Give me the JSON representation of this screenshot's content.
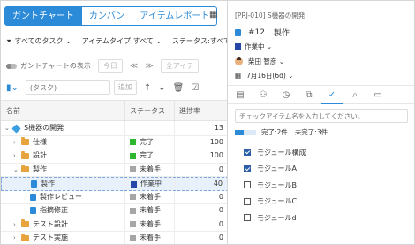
{
  "tabs": [
    {
      "label": "ガントチャート"
    },
    {
      "label": "カンバン"
    },
    {
      "label": "アイテムレポート"
    }
  ],
  "filters": [
    "すべてのタスク ⌄",
    "アイテムタイプ:すべて ⌄",
    "ステータス:すべて ⌄"
  ],
  "toolbar": {
    "gantt_toggle_label": "ガントチャートの表示",
    "today_label": "今日",
    "nav_prev": "≪",
    "nav_next": "≫",
    "all_items_label": "全アイテ"
  },
  "add_row": {
    "task_placeholder": "(タスク)",
    "add_label": "追加"
  },
  "table": {
    "columns": [
      "名前",
      "ステータス",
      "進捗率"
    ],
    "rows": [
      {
        "name": "S機器の開発",
        "status": "",
        "progress": "13"
      },
      {
        "name": "仕様",
        "status": "完了",
        "progress": "100"
      },
      {
        "name": "設計",
        "status": "完了",
        "progress": "100"
      },
      {
        "name": "製作",
        "status": "未着手",
        "progress": "0"
      },
      {
        "name": "製作",
        "status": "作業中",
        "progress": "40"
      },
      {
        "name": "製作レビュー",
        "status": "未着手",
        "progress": "0"
      },
      {
        "name": "指摘修正",
        "status": "未着手",
        "progress": "0"
      },
      {
        "name": "テスト設計",
        "status": "未着手",
        "progress": "0"
      },
      {
        "name": "テスト実施",
        "status": "未着手",
        "progress": "0"
      }
    ]
  },
  "detail": {
    "project_id": "[PRJ-010] S機器の開発",
    "item_number": "#12",
    "item_name": "製作",
    "status": "作業中 ⌄",
    "assignee": "柴田 智彦 ⌄",
    "due": "7月16日(6d) ⌄",
    "checklist_placeholder": "チェックアイテム名を入力してください。",
    "done_text": "完了:2件",
    "undone_text": "未完了:3件",
    "checklist_progress": 0.4,
    "items": [
      {
        "label": "モジュール構成",
        "checked": true
      },
      {
        "label": "モジュールA",
        "checked": true
      },
      {
        "label": "モジュールB",
        "checked": false
      },
      {
        "label": "モジュールC",
        "checked": false
      },
      {
        "label": "モジュールd",
        "checked": false
      }
    ]
  },
  "colors": {
    "accent": "#2c8bd8",
    "done": "#2fb82f",
    "in_progress": "#2747a8",
    "not_started": "#a6a6a6"
  }
}
